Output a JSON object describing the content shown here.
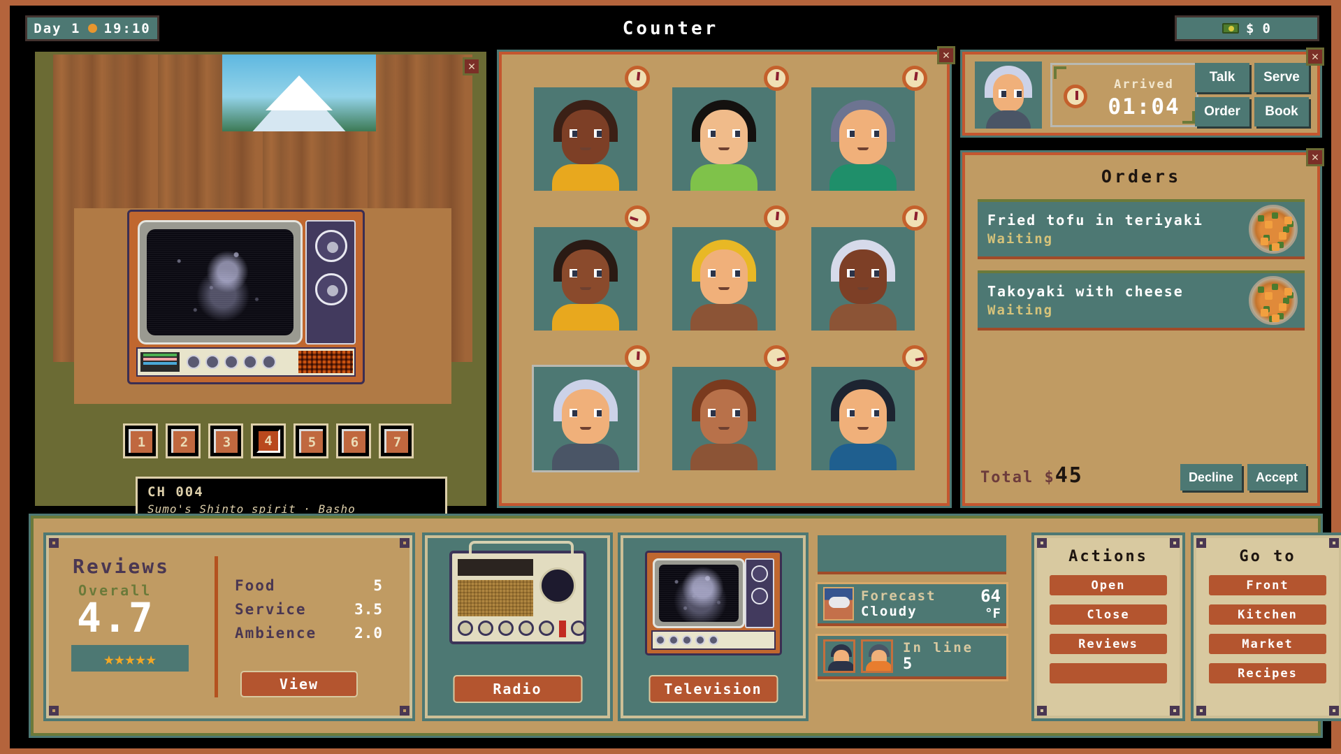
{
  "topbar": {
    "day_label": "Day 1",
    "time": "19:10",
    "time_dot_color": "#e8962e",
    "money_symbol": "$",
    "money_amount": "0",
    "screen_title": "Counter",
    "cash_icon": "cash-icon"
  },
  "tv": {
    "close_icon": "✕",
    "channels": [
      "1",
      "2",
      "3",
      "4",
      "5",
      "6",
      "7"
    ],
    "active_channel": "4",
    "channel_number": "CH 004",
    "channel_description": "Sumo's Shinto spirit · Basho"
  },
  "counter": {
    "close_icon": "✕",
    "customers": [
      {
        "id": "c1",
        "hair": "#3b2016",
        "skin": "#7d3f26",
        "shirt": "#e8a81e",
        "timer_angle": 6,
        "selected": false
      },
      {
        "id": "c2",
        "hair": "#14110f",
        "skin": "#f0bb8a",
        "shirt": "#7fc24a",
        "timer_angle": 4,
        "selected": false
      },
      {
        "id": "c3",
        "hair": "#6d7491",
        "skin": "#f0b07a",
        "shirt": "#1f8f6a",
        "timer_angle": 8,
        "selected": false
      },
      {
        "id": "c4",
        "hair": "#2a1a14",
        "skin": "#8a4a2c",
        "shirt": "#e8a81e",
        "timer_angle": -72,
        "selected": false
      },
      {
        "id": "c5",
        "hair": "#e8b825",
        "skin": "#f0b07a",
        "shirt": "#8c5436",
        "timer_angle": 5,
        "selected": false
      },
      {
        "id": "c6",
        "hair": "#d6daea",
        "skin": "#7d3f26",
        "shirt": "#8c5436",
        "timer_angle": 7,
        "selected": false
      },
      {
        "id": "c7",
        "hair": "#ccd2e8",
        "skin": "#f0b07a",
        "shirt": "#4a5566",
        "timer_angle": 3,
        "selected": true
      },
      {
        "id": "c8",
        "hair": "#7a3a1e",
        "skin": "#b8714a",
        "shirt": "#8c5436",
        "timer_angle": 78,
        "selected": false
      },
      {
        "id": "c9",
        "hair": "#1d2431",
        "skin": "#f0b07a",
        "shirt": "#1f5f8f",
        "timer_angle": 80,
        "selected": false
      }
    ]
  },
  "customer_card": {
    "close_icon": "✕",
    "arrived_label": "Arrived",
    "arrived_time": "01:04",
    "buttons": [
      "Talk",
      "Serve",
      "Order",
      "Book"
    ]
  },
  "orders": {
    "close_icon": "✕",
    "title": "Orders",
    "items": [
      {
        "name": "Fried tofu in teriyaki",
        "status": "Waiting"
      },
      {
        "name": "Takoyaki with cheese",
        "status": "Waiting"
      }
    ],
    "total_label": "Total",
    "total_symbol": "$",
    "total_amount": "45",
    "decline_label": "Decline",
    "accept_label": "Accept"
  },
  "reviews": {
    "title": "Reviews",
    "overall_label": "Overall",
    "overall_score": "4.7",
    "stars": "★★★★★",
    "metrics": [
      {
        "label": "Food",
        "value": "5"
      },
      {
        "label": "Service",
        "value": "3.5"
      },
      {
        "label": "Ambience",
        "value": "2.0"
      }
    ],
    "view_label": "View"
  },
  "devices": {
    "radio_label": "Radio",
    "television_label": "Television"
  },
  "status": {
    "forecast_label": "Forecast",
    "forecast_condition": "Cloudy",
    "forecast_temp": "64",
    "forecast_unit": "°F",
    "in_line_label": "In line",
    "in_line_count": "5"
  },
  "actions": {
    "title": "Actions",
    "buttons": [
      "Open",
      "Close",
      "Reviews",
      ""
    ]
  },
  "goto": {
    "title": "Go to",
    "buttons": [
      "Front",
      "Kitchen",
      "Market",
      "Recipes"
    ]
  }
}
